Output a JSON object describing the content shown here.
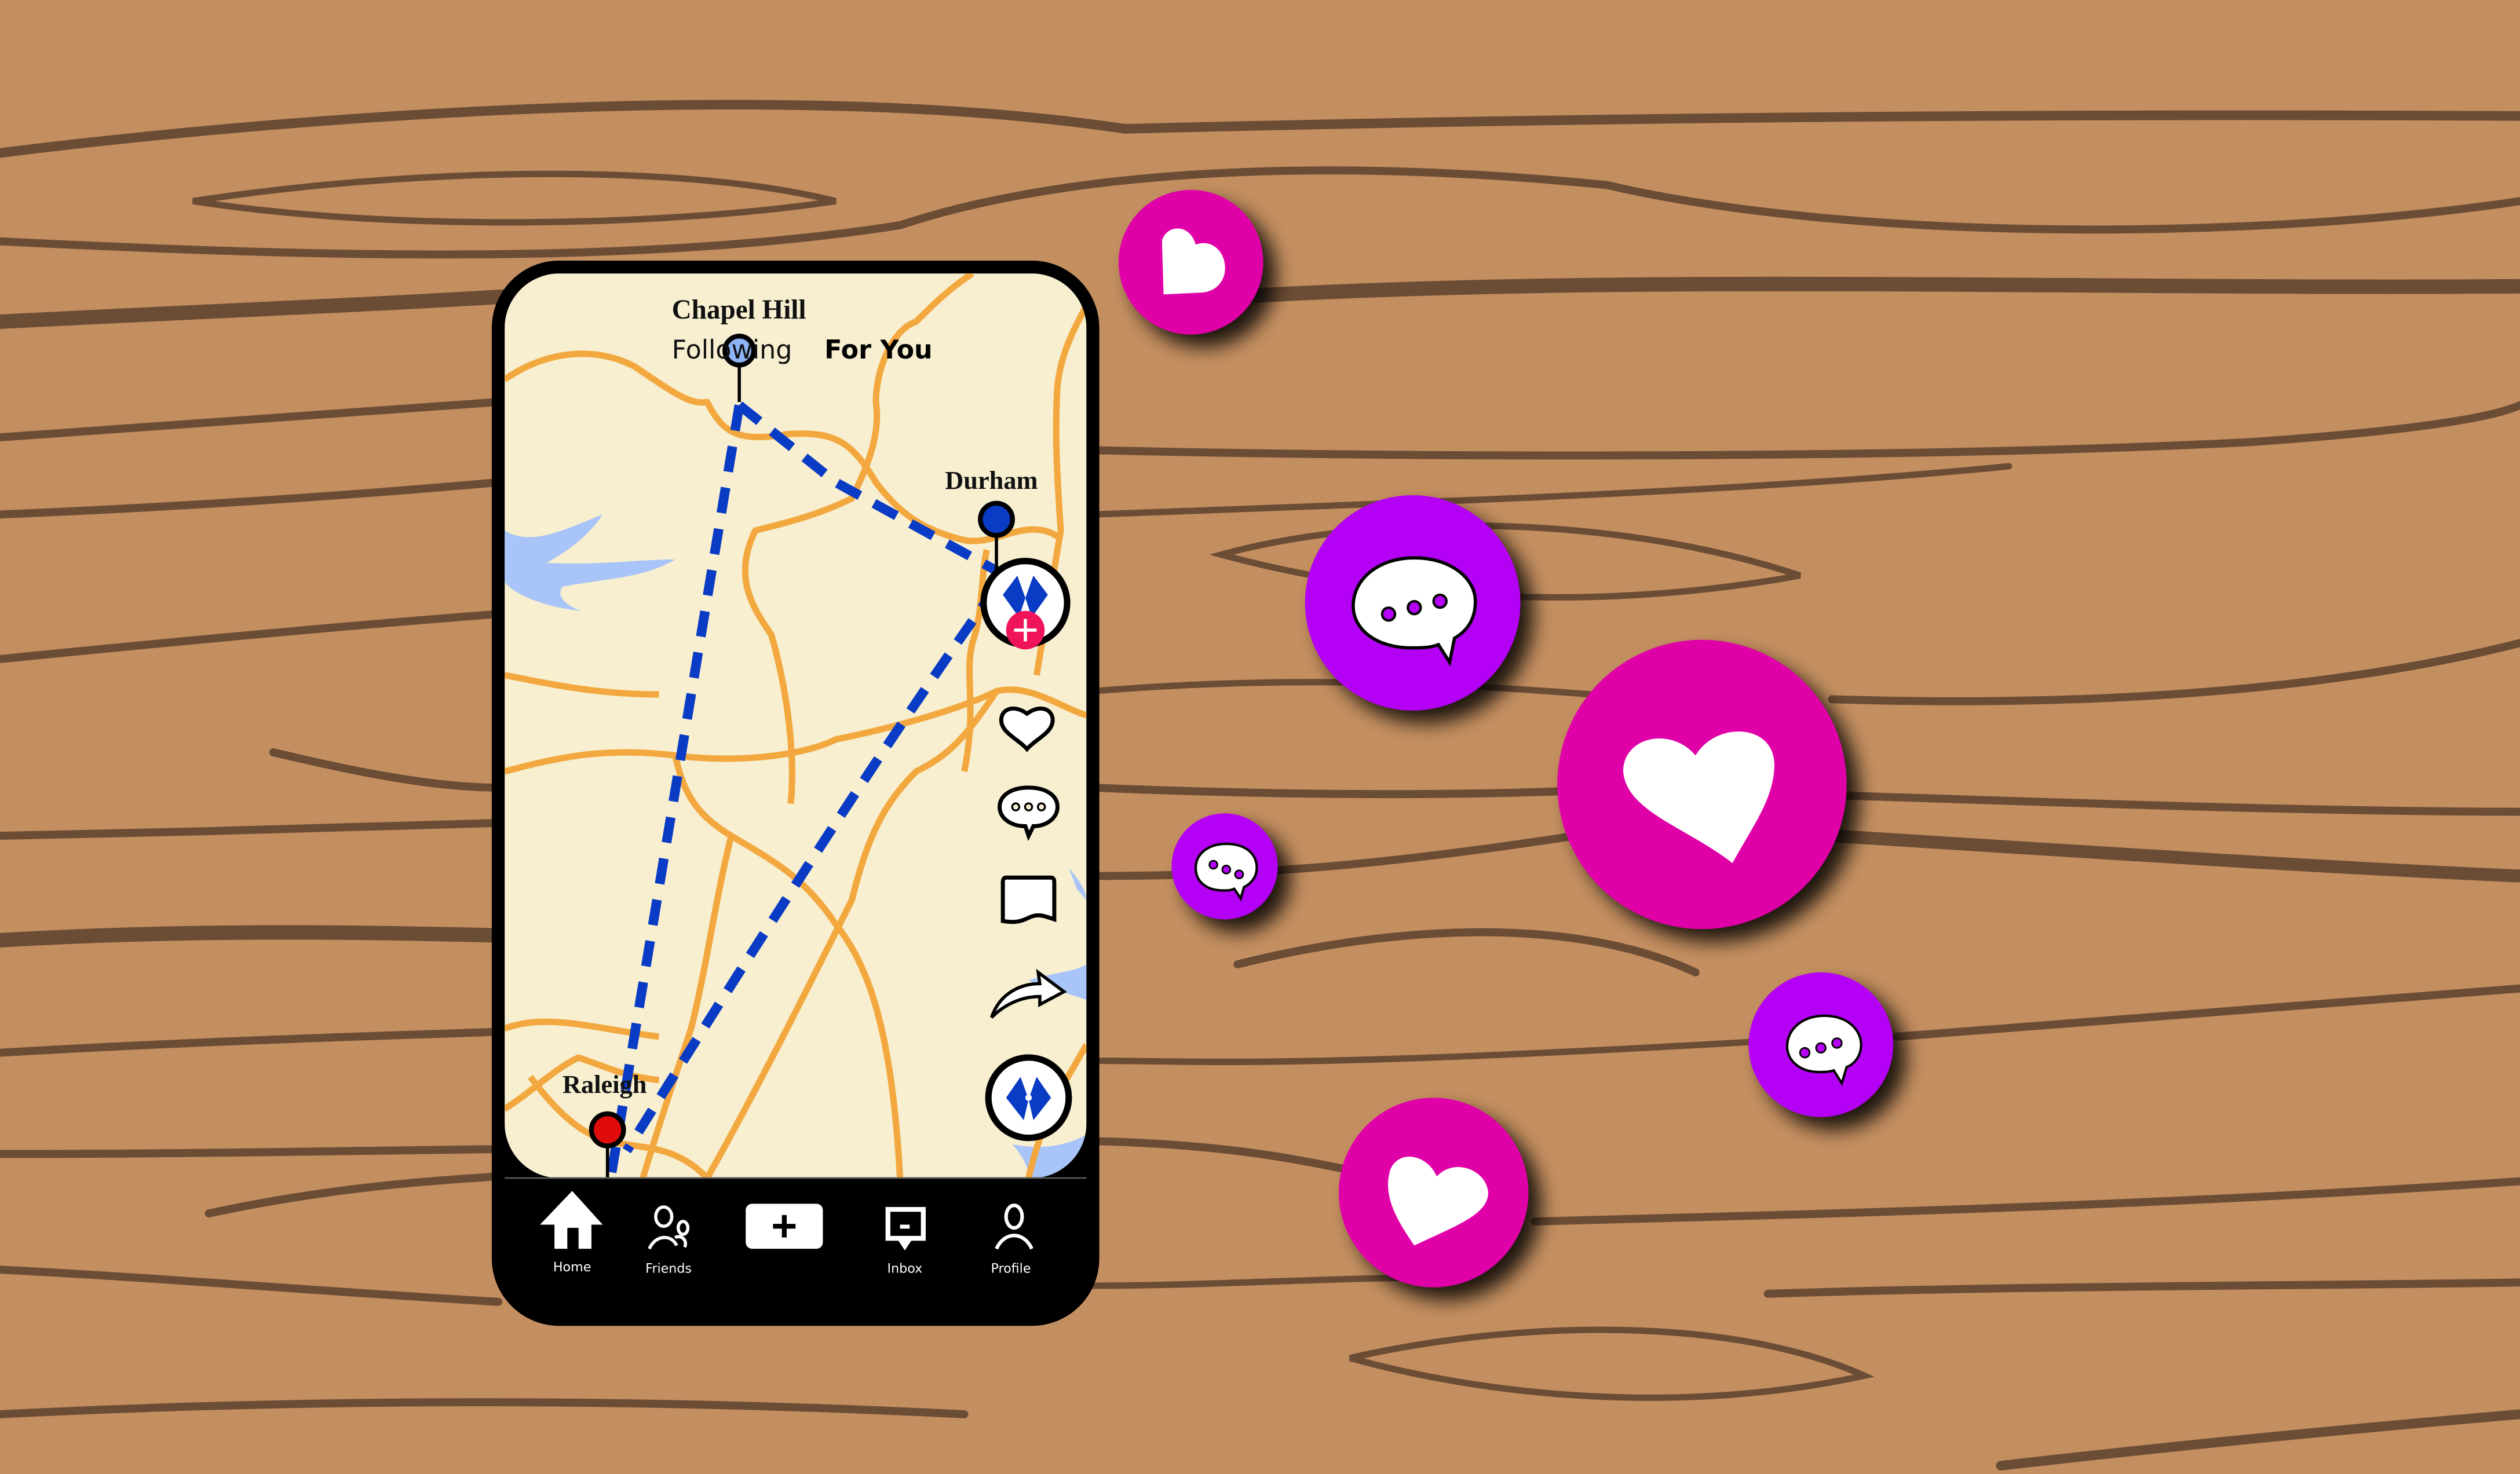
{
  "scene": {
    "colors": {
      "wood": "#c48f60",
      "grain": "#6b4c35",
      "map_bg": "#f7efd0",
      "road": "#f3a83f",
      "water": "#a8c4f8",
      "route": "#0a3bc4",
      "phone_frame": "#000000",
      "like_bubble": "#e000a8",
      "comment_bubble": "#b400f5",
      "follow_badge": "#f0145a",
      "raleigh_pin": "#e00c0c",
      "durham_pin": "#0a3bc4",
      "chapel_hill_pin": "#8db4f5"
    }
  },
  "feed_tabs": {
    "following": "Following",
    "for_you": "For You"
  },
  "map": {
    "cities": [
      {
        "name": "Chapel Hill"
      },
      {
        "name": "Durham"
      },
      {
        "name": "Raleigh"
      }
    ]
  },
  "actions": {
    "follow_badge_icon": "plus-icon",
    "like_icon": "heart-icon",
    "comment_icon": "speech-bubble-icon",
    "save_icon": "bookmark-icon",
    "share_icon": "share-arrow-icon",
    "sound_icon": "pen-nib-icon"
  },
  "bottom_nav": {
    "items": [
      {
        "label": "Home",
        "icon": "home-icon"
      },
      {
        "label": "Friends",
        "icon": "friends-icon"
      },
      {
        "label": "",
        "icon": "plus-icon"
      },
      {
        "label": "Inbox",
        "icon": "inbox-icon"
      },
      {
        "label": "Profile",
        "icon": "profile-icon"
      }
    ]
  },
  "floating_bubbles": [
    {
      "type": "like",
      "icon": "heart-icon"
    },
    {
      "type": "comment",
      "icon": "speech-bubble-icon"
    },
    {
      "type": "like",
      "icon": "heart-icon"
    },
    {
      "type": "comment",
      "icon": "speech-bubble-icon"
    },
    {
      "type": "comment",
      "icon": "speech-bubble-icon"
    },
    {
      "type": "like",
      "icon": "heart-icon"
    }
  ]
}
